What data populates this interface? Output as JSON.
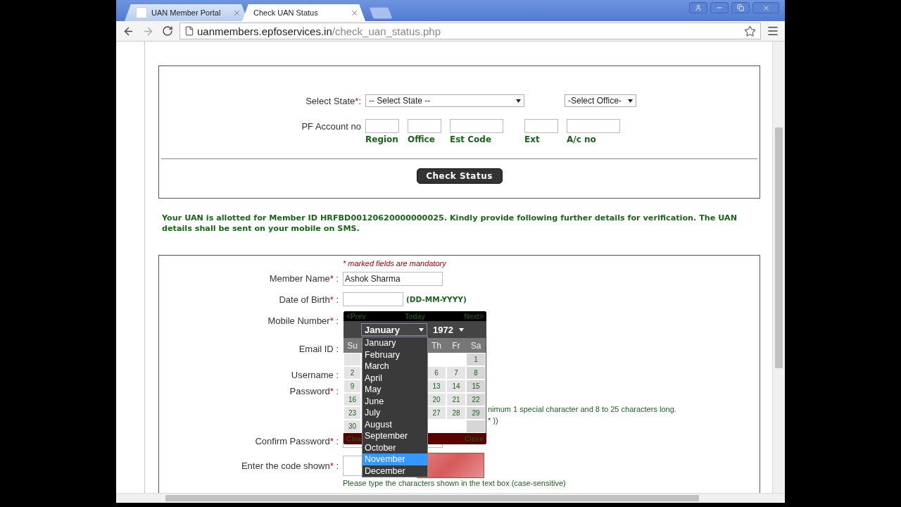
{
  "browser": {
    "tabs": [
      {
        "title": "UAN Member Portal",
        "selected": false
      },
      {
        "title": "Check UAN Status",
        "selected": true
      }
    ],
    "address": {
      "host": "uanmembers.epfoservices.in",
      "path": "/check_uan_status.php"
    }
  },
  "status_form": {
    "state_label": "Select State",
    "state_mark": "*",
    "state_separator": ":",
    "state_select": "-- Select State --",
    "office_select": "-Select Office-",
    "account_label": "PF Account no",
    "account_fields": [
      {
        "label": "Region",
        "kind": "short"
      },
      {
        "label": "Office",
        "kind": "short"
      },
      {
        "label": "Est Code",
        "kind": "long"
      },
      {
        "label": "Ext",
        "kind": "short"
      },
      {
        "label": "A/c no",
        "kind": "long"
      }
    ],
    "button": "Check Status"
  },
  "message": "Your UAN is allotted for Member ID HRFBD00120620000000025. Kindly provide following further details for verification. The UAN details shall be sent on your mobile on SMS.",
  "member_form": {
    "note": "* marked fields are mandatory",
    "rows": [
      {
        "kind": "text",
        "label": "Member Name",
        "mark": "*",
        "separator": ":",
        "value": "Ashok Sharma"
      },
      {
        "kind": "date",
        "label": "Date of Birth",
        "mark": "*",
        "separator": ":",
        "hint": "(DD-MM-YYYY)"
      },
      {
        "kind": "covered",
        "label": "Mobile Number",
        "mark": "*",
        "separator": ":"
      },
      {
        "kind": "covered",
        "label": "Email ID",
        "separator": ":"
      },
      {
        "kind": "covered",
        "label": "Username",
        "separator": ":"
      },
      {
        "kind": "password",
        "label": "Password",
        "mark": "*",
        "separator": ":",
        "hints": [
          "nimum 1 special character and 8 to 25 characters long.",
          "* ))"
        ]
      },
      {
        "kind": "text",
        "label": "Confirm Password",
        "mark": "*",
        "separator": ":"
      },
      {
        "kind": "captcha",
        "label": "Enter the code shown",
        "mark": "*",
        "separator": ":",
        "help": "Please type the characters shown in the text box (case-sensitive)"
      }
    ]
  },
  "calendar": {
    "prev": "<Prev",
    "today": "Today",
    "next": "Next>",
    "month": "January",
    "year": "1972",
    "clear": "Clea",
    "close": "Close",
    "weekdays": {
      "su": "Su",
      "th": "Th",
      "fr": "Fr",
      "sa": "Sa"
    },
    "weeks": [
      {
        "sa": "1"
      },
      {
        "su": "2",
        "th": "6",
        "fr": "7",
        "sa": "8"
      },
      {
        "su": "9",
        "th": "13",
        "fr": "14",
        "sa": "15"
      },
      {
        "su": "16",
        "th": "20",
        "fr": "21",
        "sa": "22"
      },
      {
        "su": "23",
        "th": "27",
        "fr": "28",
        "sa": "29"
      },
      {
        "su": "30"
      }
    ],
    "months": [
      {
        "name": "January",
        "selected": false
      },
      {
        "name": "February",
        "selected": false
      },
      {
        "name": "March",
        "selected": false
      },
      {
        "name": "April",
        "selected": false
      },
      {
        "name": "May",
        "selected": false
      },
      {
        "name": "June",
        "selected": false
      },
      {
        "name": "July",
        "selected": false
      },
      {
        "name": "August",
        "selected": false
      },
      {
        "name": "September",
        "selected": false
      },
      {
        "name": "October",
        "selected": false
      },
      {
        "name": "November",
        "selected": true
      },
      {
        "name": "December",
        "selected": false
      }
    ]
  }
}
